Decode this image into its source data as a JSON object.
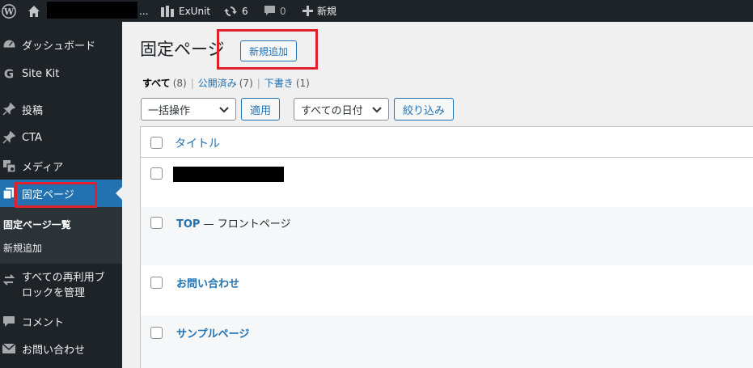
{
  "adminbar": {
    "site_name": "ExUnit",
    "updates_count": "6",
    "comments_count": "0",
    "new_label": "新規",
    "dots": "..."
  },
  "sidebar": {
    "items": [
      {
        "label": "ダッシュボード",
        "icon": "dashboard-icon"
      },
      {
        "label": "Site Kit",
        "icon": "site-kit-g-icon"
      },
      {
        "label": "投稿",
        "icon": "pin-icon"
      },
      {
        "label": "CTA",
        "icon": "pin-icon"
      },
      {
        "label": "メディア",
        "icon": "media-icon"
      },
      {
        "label": "固定ページ",
        "icon": "pages-icon"
      },
      {
        "label_line1": "すべての再利用ブ",
        "label_line2": "ロックを管理",
        "icon": "reusable-blocks-icon"
      },
      {
        "label": "コメント",
        "icon": "comment-icon"
      },
      {
        "label": "お問い合わせ",
        "icon": "mail-icon"
      }
    ],
    "submenu": [
      {
        "label": "固定ページ一覧",
        "active": true
      },
      {
        "label": "新規追加",
        "active": false
      }
    ]
  },
  "main": {
    "title": "固定ページ",
    "add_new_label": "新規追加",
    "filters": [
      {
        "label": "すべて",
        "count": "(8)",
        "current": true
      },
      {
        "label": "公開済み",
        "count": "(7)",
        "current": false
      },
      {
        "label": "下書き",
        "count": "(1)",
        "current": false
      }
    ],
    "separator": "|",
    "bulk_action": "一括操作",
    "apply_label": "適用",
    "date_filter": "すべての日付",
    "filter_label": "絞り込み",
    "table": {
      "column_title": "タイトル",
      "rows": [
        {
          "title": "",
          "state": "",
          "redacted": true
        },
        {
          "title": "TOP",
          "state": " — フロントページ",
          "redacted": false
        },
        {
          "title": "お問い合わせ",
          "state": "",
          "redacted": false
        },
        {
          "title": "サンプルページ",
          "state": "",
          "redacted": false
        }
      ]
    }
  },
  "colors": {
    "admin_dark": "#1d2327",
    "accent_blue": "#2271b1",
    "highlight_red": "#e0202a"
  }
}
